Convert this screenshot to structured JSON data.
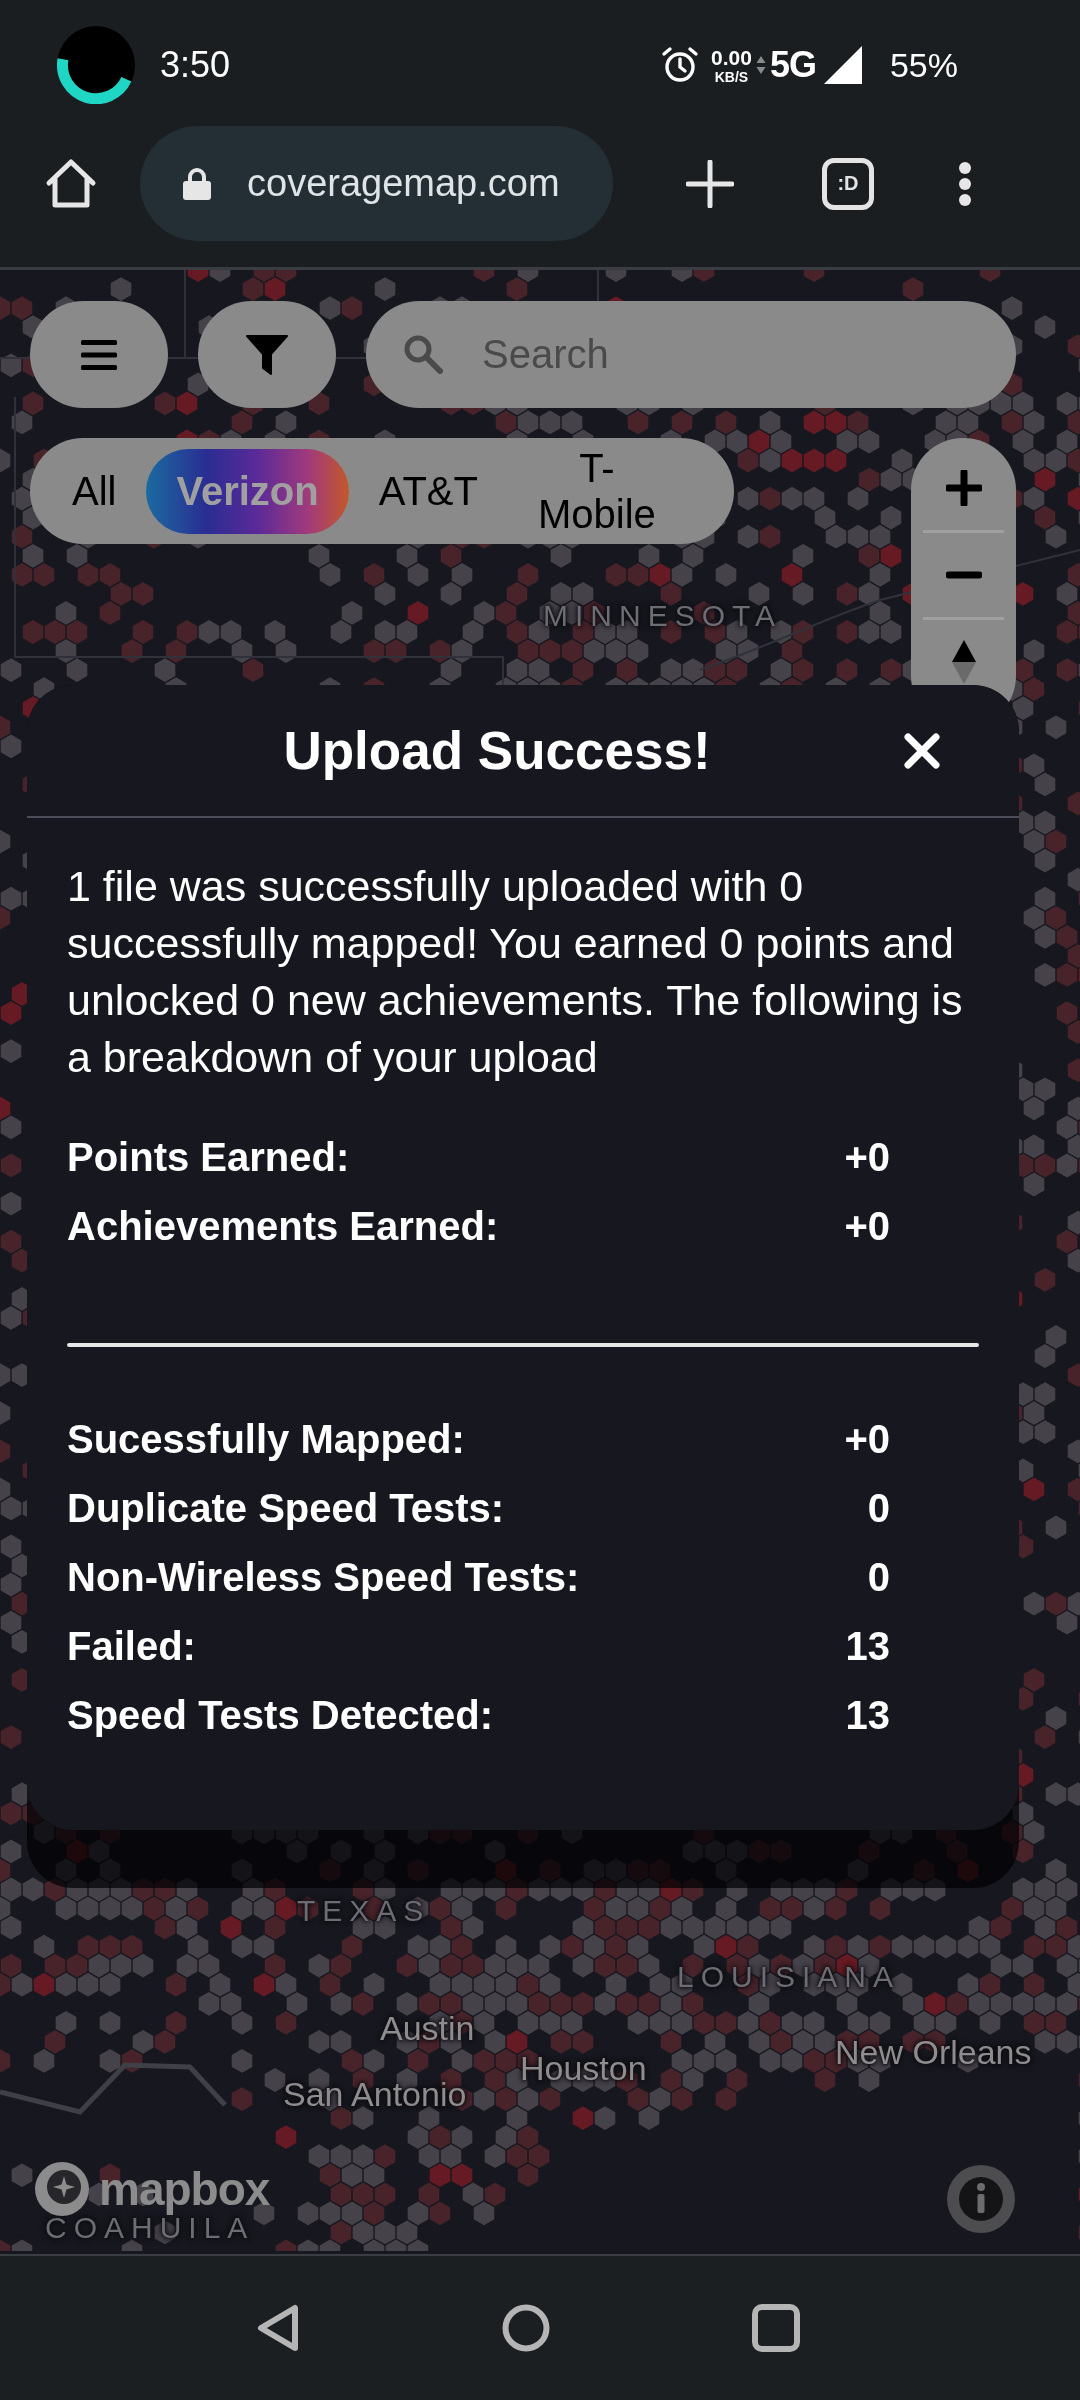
{
  "status_bar": {
    "time": "3:50",
    "data_rate": "0.00",
    "data_unit": "KB/S",
    "network": "5G",
    "battery": "55%"
  },
  "browser": {
    "url": "coveragemap.com",
    "tab_button": ":D"
  },
  "map_controls": {
    "search": {
      "placeholder": "Search"
    },
    "carriers": [
      {
        "label": "All",
        "selected": false
      },
      {
        "label": "Verizon",
        "selected": true
      },
      {
        "label": "AT&T",
        "selected": false
      },
      {
        "label": "T-Mobile",
        "selected": false
      }
    ]
  },
  "map": {
    "labels": [
      {
        "text": "MINNESOTA",
        "kind": "region"
      },
      {
        "text": "TEXAS",
        "kind": "region"
      },
      {
        "text": "LOUISIANA",
        "kind": "region"
      },
      {
        "text": "Austin",
        "kind": "city"
      },
      {
        "text": "New Orleans",
        "kind": "city"
      },
      {
        "text": "Houston",
        "kind": "city"
      },
      {
        "text": "San Antonio",
        "kind": "city"
      },
      {
        "text": "COAHUILA",
        "kind": "region"
      }
    ],
    "logo": "mapbox"
  },
  "dialog": {
    "title": "Upload Success!",
    "message": "1 file was successfully uploaded with 0 successfully mapped! You earned 0 points and unlocked 0 new achievements. The following is a breakdown of your upload",
    "summary": [
      {
        "label": "Points Earned:",
        "value": "+0"
      },
      {
        "label": "Achievements Earned:",
        "value": "+0"
      }
    ],
    "breakdown": [
      {
        "label": "Sucessfully Mapped:",
        "value": "+0"
      },
      {
        "label": "Duplicate Speed Tests:",
        "value": "0"
      },
      {
        "label": "Non-Wireless Speed Tests:",
        "value": "0"
      },
      {
        "label": "Failed:",
        "value": "13"
      },
      {
        "label": "Speed Tests Detected:",
        "value": "13"
      }
    ]
  }
}
